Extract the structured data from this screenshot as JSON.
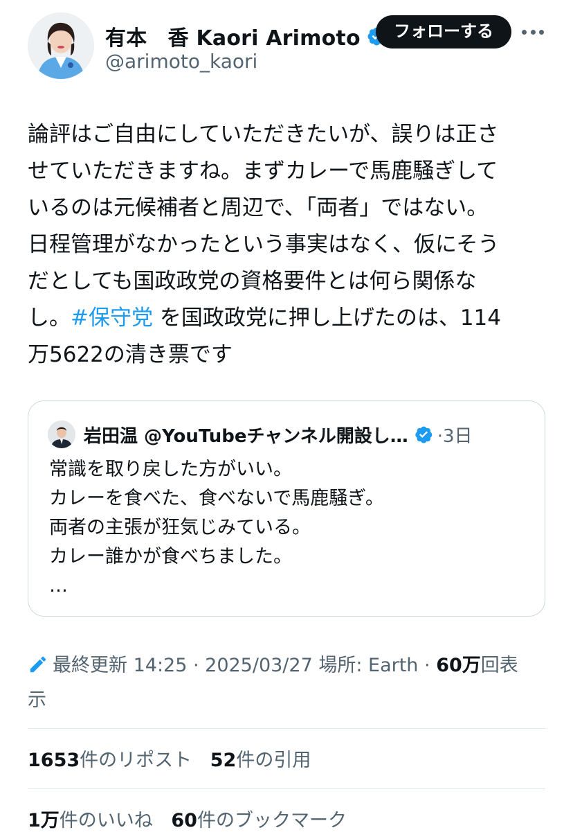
{
  "author": {
    "display_name": "有本　香  Kaori Arimoto",
    "handle": "@arimoto_kaori",
    "follow_label": "フォローする",
    "verified_color": "#1d9bf0"
  },
  "tweet": {
    "lines": [
      "論評はご自由にしていただきたいが、誤りは正さ",
      "せていただきますね。まずカレーで馬鹿騒ぎして",
      "いるのは元候補者と周辺で、「両者」ではない。",
      "日程管理がなかったという事実はなく、仮にそう",
      "だとしても国政政党の資格要件とは何ら関係な"
    ],
    "line6_prefix": "し。",
    "hashtag": "#保守党",
    "line6_suffix": " を国政政党に押し上げたのは、114",
    "line7": "万5622の清き票です"
  },
  "quote": {
    "name": "岩田温 @YouTubeチャンネル開設し…",
    "time": "·3日",
    "lines": [
      "常識を取り戻した方がいい。",
      "カレーを食べた、食べないで馬鹿騒ぎ。",
      "両者の主張が狂気じみている。",
      "カレー誰かが食べちました。",
      "…"
    ]
  },
  "meta": {
    "edited": "最終更新 14:25 · 2025/03/27  場所: Earth · ",
    "views_count": "60万",
    "views_label_a": "回表",
    "views_label_b": "示"
  },
  "stats": {
    "reposts_count": "1653",
    "reposts_label": "件のリポスト",
    "quotes_count": "52",
    "quotes_label": "件の引用",
    "likes_count": "1万",
    "likes_label": "件のいいね",
    "bookmarks_count": "60",
    "bookmarks_label": "件のブックマーク"
  }
}
